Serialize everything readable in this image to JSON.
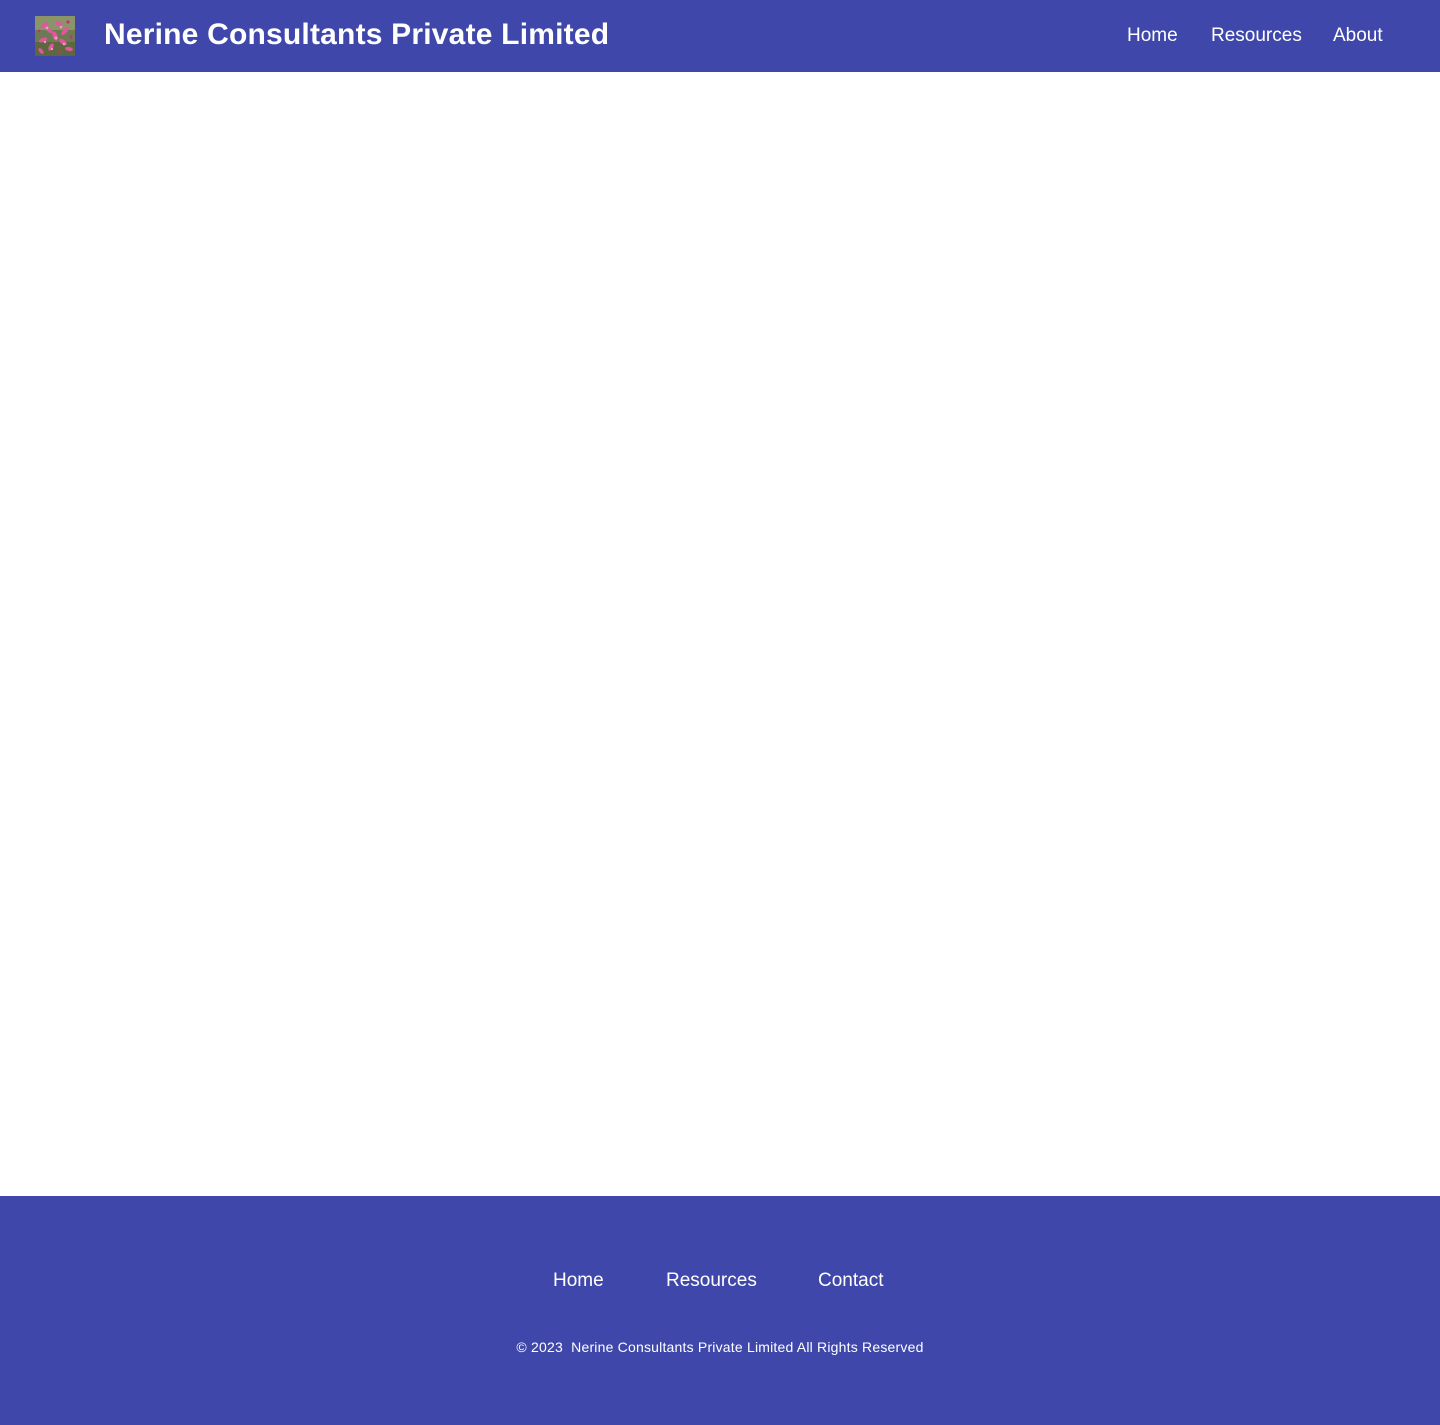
{
  "header": {
    "logo_icon": "pink-flower-logo-icon",
    "site_title": "Nerine Consultants Private Limited",
    "nav": [
      {
        "label": "Home"
      },
      {
        "label": "Resources"
      },
      {
        "label": "About"
      }
    ]
  },
  "footer": {
    "nav": [
      {
        "label": "Home"
      },
      {
        "label": "Resources"
      },
      {
        "label": "Contact"
      }
    ],
    "copyright": "© 2023  Nerine Consultants Private Limited All Rights Reserved"
  },
  "colors": {
    "brand": "#3f48aa",
    "text_on_brand": "#ffffff",
    "background": "#ffffff"
  }
}
